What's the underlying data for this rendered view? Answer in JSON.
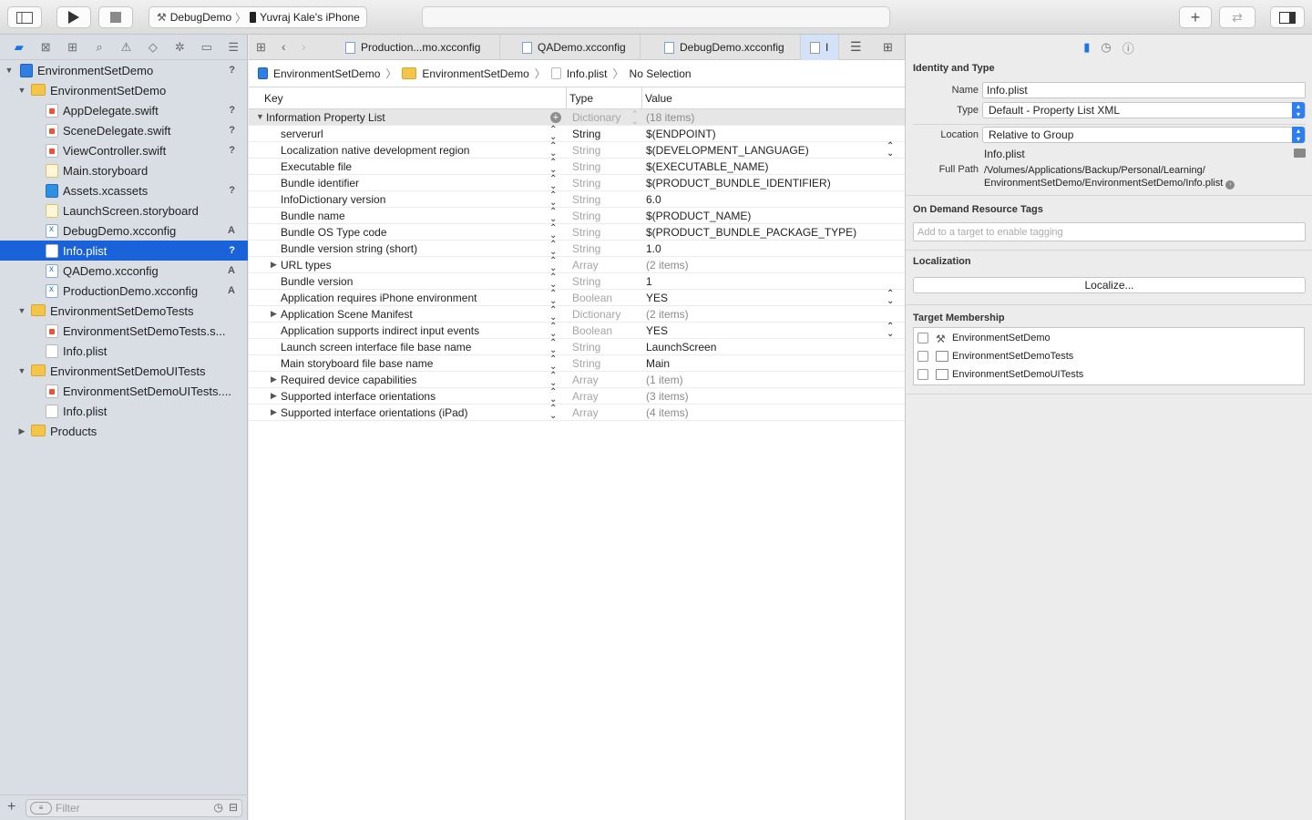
{
  "toolbar": {
    "scheme_name": "DebugDemo",
    "device_name": "Yuvraj  Kale's iPhone",
    "run_icon": "play-icon",
    "stop_icon": "stop-icon",
    "add_icon": "plus-icon"
  },
  "navigator": {
    "tabs": [
      "folder-icon",
      "source-control-icon",
      "symbol-icon",
      "search-icon",
      "issue-icon",
      "test-icon",
      "debug-icon",
      "breakpoint-icon",
      "report-icon"
    ],
    "items": [
      {
        "label": "EnvironmentSetDemo",
        "status": "?",
        "kind": "proj",
        "depth": 0,
        "disclosure": "▼"
      },
      {
        "label": "EnvironmentSetDemo",
        "status": "",
        "kind": "folder",
        "depth": 1,
        "disclosure": "▼"
      },
      {
        "label": "AppDelegate.swift",
        "status": "?",
        "kind": "swift",
        "depth": 2,
        "disclosure": ""
      },
      {
        "label": "SceneDelegate.swift",
        "status": "?",
        "kind": "swift",
        "depth": 2,
        "disclosure": ""
      },
      {
        "label": "ViewController.swift",
        "status": "?",
        "kind": "swift",
        "depth": 2,
        "disclosure": ""
      },
      {
        "label": "Main.storyboard",
        "status": "",
        "kind": "sb",
        "depth": 2,
        "disclosure": ""
      },
      {
        "label": "Assets.xcassets",
        "status": "?",
        "kind": "assets",
        "depth": 2,
        "disclosure": ""
      },
      {
        "label": "LaunchScreen.storyboard",
        "status": "",
        "kind": "sb",
        "depth": 2,
        "disclosure": ""
      },
      {
        "label": "DebugDemo.xcconfig",
        "status": "A",
        "kind": "xcfg",
        "depth": 2,
        "disclosure": ""
      },
      {
        "label": "Info.plist",
        "status": "?",
        "kind": "doc",
        "depth": 2,
        "disclosure": "",
        "selected": true
      },
      {
        "label": "QADemo.xcconfig",
        "status": "A",
        "kind": "xcfg",
        "depth": 2,
        "disclosure": ""
      },
      {
        "label": "ProductionDemo.xcconfig",
        "status": "A",
        "kind": "xcfg",
        "depth": 2,
        "disclosure": ""
      },
      {
        "label": "EnvironmentSetDemoTests",
        "status": "",
        "kind": "folder",
        "depth": 1,
        "disclosure": "▼"
      },
      {
        "label": "EnvironmentSetDemoTests.s...",
        "status": "",
        "kind": "swift",
        "depth": 2,
        "disclosure": ""
      },
      {
        "label": "Info.plist",
        "status": "",
        "kind": "doc",
        "depth": 2,
        "disclosure": ""
      },
      {
        "label": "EnvironmentSetDemoUITests",
        "status": "",
        "kind": "folder",
        "depth": 1,
        "disclosure": "▼"
      },
      {
        "label": "EnvironmentSetDemoUITests....",
        "status": "",
        "kind": "swift",
        "depth": 2,
        "disclosure": ""
      },
      {
        "label": "Info.plist",
        "status": "",
        "kind": "doc",
        "depth": 2,
        "disclosure": ""
      },
      {
        "label": "Products",
        "status": "",
        "kind": "folder",
        "depth": 1,
        "disclosure": "▶"
      }
    ],
    "filter_placeholder": "Filter"
  },
  "editor": {
    "tabs": [
      {
        "label": "Production...mo.xcconfig",
        "active": false
      },
      {
        "label": "QADemo.xcconfig",
        "active": false
      },
      {
        "label": "DebugDemo.xcconfig",
        "active": false
      },
      {
        "label": "I",
        "active": true
      }
    ],
    "jumpbar": [
      "EnvironmentSetDemo",
      "EnvironmentSetDemo",
      "Info.plist",
      "No Selection"
    ],
    "columns": {
      "key": "Key",
      "type": "Type",
      "value": "Value"
    },
    "rows": [
      {
        "key": "Information Property List",
        "type": "Dictionary",
        "value": "(18 items)",
        "root": true,
        "disclosure": "▼"
      },
      {
        "key": "serverurl",
        "type": "String",
        "value": "$(ENDPOINT)",
        "strong_type": true
      },
      {
        "key": "Localization native development region",
        "type": "String",
        "value": "$(DEVELOPMENT_LANGUAGE)",
        "value_stepper": true
      },
      {
        "key": "Executable file",
        "type": "String",
        "value": "$(EXECUTABLE_NAME)"
      },
      {
        "key": "Bundle identifier",
        "type": "String",
        "value": "$(PRODUCT_BUNDLE_IDENTIFIER)"
      },
      {
        "key": "InfoDictionary version",
        "type": "String",
        "value": "6.0"
      },
      {
        "key": "Bundle name",
        "type": "String",
        "value": "$(PRODUCT_NAME)"
      },
      {
        "key": "Bundle OS Type code",
        "type": "String",
        "value": "$(PRODUCT_BUNDLE_PACKAGE_TYPE)"
      },
      {
        "key": "Bundle version string (short)",
        "type": "String",
        "value": "1.0"
      },
      {
        "key": "URL types",
        "type": "Array",
        "value": "(2 items)",
        "disclosure": "▶",
        "muted_value": true
      },
      {
        "key": "Bundle version",
        "type": "String",
        "value": "1"
      },
      {
        "key": "Application requires iPhone environment",
        "type": "Boolean",
        "value": "YES",
        "value_stepper": true
      },
      {
        "key": "Application Scene Manifest",
        "type": "Dictionary",
        "value": "(2 items)",
        "disclosure": "▶",
        "muted_value": true
      },
      {
        "key": "Application supports indirect input events",
        "type": "Boolean",
        "value": "YES",
        "value_stepper": true
      },
      {
        "key": "Launch screen interface file base name",
        "type": "String",
        "value": "LaunchScreen"
      },
      {
        "key": "Main storyboard file base name",
        "type": "String",
        "value": "Main"
      },
      {
        "key": "Required device capabilities",
        "type": "Array",
        "value": "(1 item)",
        "disclosure": "▶",
        "muted_value": true
      },
      {
        "key": "Supported interface orientations",
        "type": "Array",
        "value": "(3 items)",
        "disclosure": "▶",
        "muted_value": true
      },
      {
        "key": "Supported interface orientations (iPad)",
        "type": "Array",
        "value": "(4 items)",
        "disclosure": "▶",
        "muted_value": true
      }
    ]
  },
  "inspector": {
    "identity_title": "Identity and Type",
    "name_label": "Name",
    "name_value": "Info.plist",
    "type_label": "Type",
    "type_value": "Default - Property List XML",
    "location_label": "Location",
    "location_value": "Relative to Group",
    "location_file": "Info.plist",
    "fullpath_label": "Full Path",
    "fullpath_line1": "/Volumes/Applications/Backup/Personal/Learning/",
    "fullpath_line2": "EnvironmentSetDemo/EnvironmentSetDemo/Info.plist",
    "odr_title": "On Demand Resource Tags",
    "odr_placeholder": "Add to a target to enable tagging",
    "localization_title": "Localization",
    "localize_button": "Localize...",
    "target_title": "Target Membership",
    "targets": [
      "EnvironmentSetDemo",
      "EnvironmentSetDemoTests",
      "EnvironmentSetDemoUITests"
    ]
  }
}
